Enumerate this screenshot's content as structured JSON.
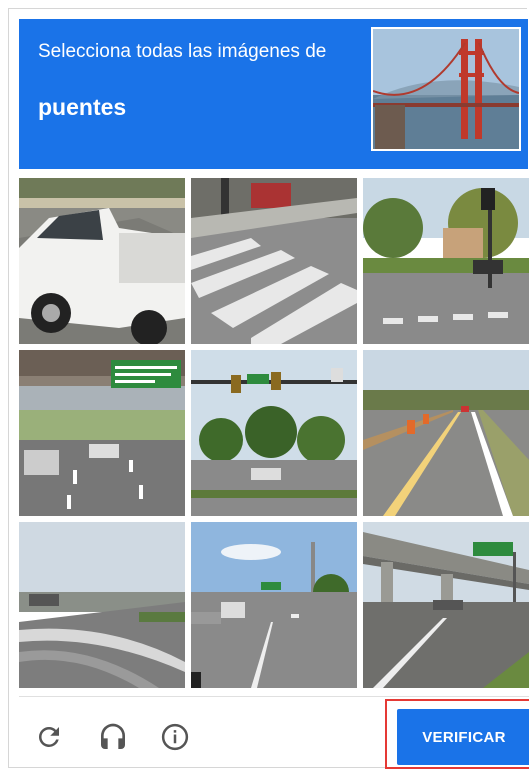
{
  "header": {
    "instruction": "Selecciona todas las imágenes de",
    "target": "puentes",
    "background_color": "#1a73e8"
  },
  "grid": {
    "rows": 3,
    "cols": 3,
    "tiles": [
      {
        "scene": "white-pickup-truck"
      },
      {
        "scene": "crosswalk-pavement"
      },
      {
        "scene": "road-with-traffic-light-and-trees"
      },
      {
        "scene": "highway-under-overpass-with-green-sign"
      },
      {
        "scene": "intersection-traffic-lights-trees"
      },
      {
        "scene": "highway-with-construction-barrels"
      },
      {
        "scene": "highway-overpass-ramp"
      },
      {
        "scene": "city-street-with-cars"
      },
      {
        "scene": "bridge-overpass-with-green-sign"
      }
    ]
  },
  "footer": {
    "reload_icon": "reload-icon",
    "audio_icon": "headphones-icon",
    "info_icon": "info-icon",
    "verify_label": "VERIFICAR",
    "highlight_color": "#e53935"
  }
}
